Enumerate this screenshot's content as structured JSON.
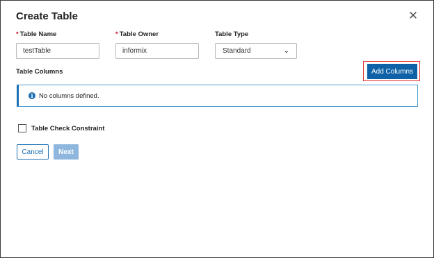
{
  "dialog": {
    "title": "Create Table",
    "close_icon": "close-icon"
  },
  "form": {
    "table_name": {
      "required_mark": "*",
      "label": "Table Name",
      "value": "testTable"
    },
    "table_owner": {
      "required_mark": "*",
      "label": "Table Owner",
      "value": "informix"
    },
    "table_type": {
      "label": "Table Type",
      "selected": "Standard",
      "icon": "chevron-down-icon"
    }
  },
  "columns": {
    "label": "Table Columns",
    "add_button": "Add Columns",
    "empty_message": "No columns defined.",
    "info_icon": "info-icon"
  },
  "check_constraint": {
    "label": "Table Check Constraint",
    "checked": false
  },
  "actions": {
    "cancel": "Cancel",
    "next": "Next"
  },
  "colors": {
    "primary": "#0f62a8",
    "disabled": "#8fb7de",
    "highlight": "#e03030",
    "required": "#c8102e"
  }
}
